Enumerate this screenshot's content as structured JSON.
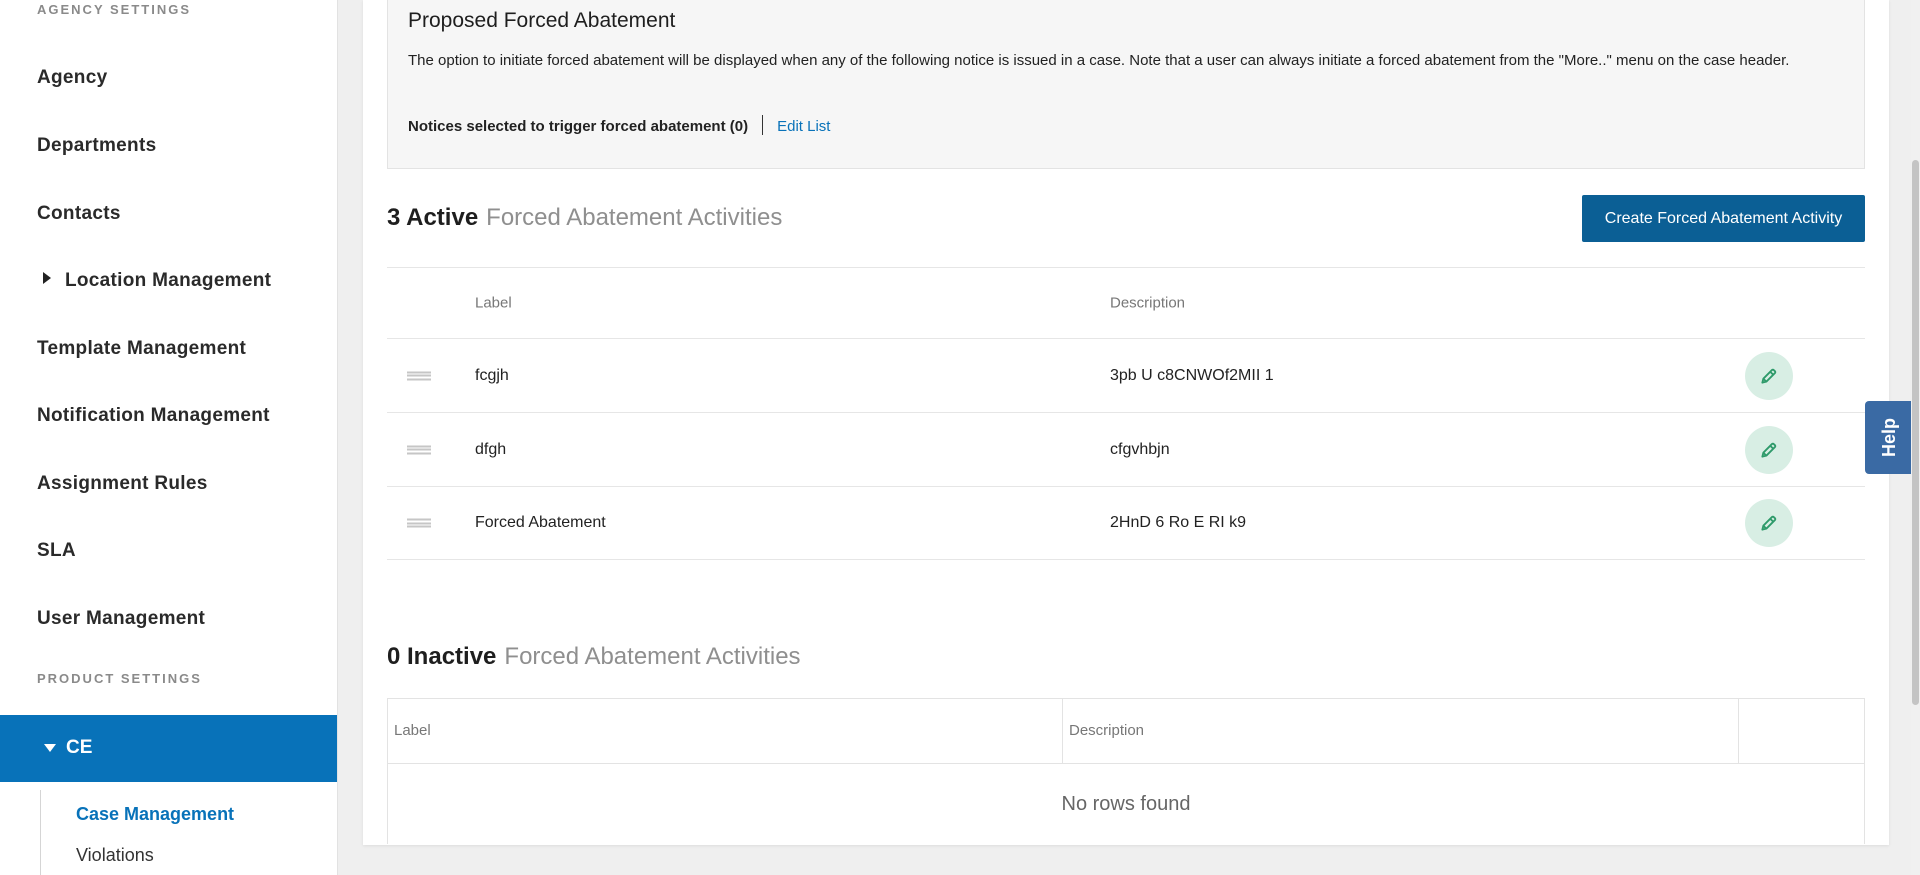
{
  "sidebar": {
    "agency_settings_label": "AGENCY SETTINGS",
    "items": [
      {
        "label": "Agency"
      },
      {
        "label": "Departments"
      },
      {
        "label": "Contacts"
      },
      {
        "label": "Location Management",
        "expandable": true
      },
      {
        "label": "Template Management"
      },
      {
        "label": "Notification Management"
      },
      {
        "label": "Assignment Rules"
      },
      {
        "label": "SLA"
      },
      {
        "label": "User Management"
      }
    ],
    "product_settings_label": "PRODUCT SETTINGS",
    "active_item": {
      "label": "CE",
      "expanded": true
    },
    "sub_items": [
      {
        "label": "Case Management",
        "current": true
      },
      {
        "label": "Violations"
      }
    ]
  },
  "proposed": {
    "title": "Proposed Forced Abatement",
    "description": "The option to initiate forced abatement will be displayed when any of the following notice is issued in a case. Note that a user can always initiate a forced abatement from the \"More..\" menu on the case header.",
    "notices_label": "Notices selected to trigger forced abatement (0)",
    "edit_link": "Edit List"
  },
  "active": {
    "count_label": "3 Active",
    "section_label": "Forced Abatement Activities",
    "create_button": "Create Forced Abatement Activity",
    "columns": {
      "label": "Label",
      "description": "Description"
    },
    "rows": [
      {
        "label": "fcgjh",
        "description": "3pb U c8CNWOf2MII 1"
      },
      {
        "label": "dfgh",
        "description": "cfgvhbjn"
      },
      {
        "label": "Forced Abatement",
        "description": "2HnD 6 Ro E RI k9"
      }
    ]
  },
  "inactive": {
    "count_label": "0 Inactive",
    "section_label": "Forced Abatement Activities",
    "columns": {
      "label": "Label",
      "description": "Description"
    },
    "empty_text": "No rows found"
  },
  "help": {
    "label": "Help"
  },
  "colors": {
    "primary": "#0872b9",
    "button": "#0b5f95",
    "edit_icon": "#2e9a6a",
    "edit_bg": "#d8eee4",
    "help_tab": "#3a6aa4"
  },
  "icons": {
    "drag": "drag-handle-icon",
    "edit": "pencil-icon",
    "expand": "caret-right-icon",
    "collapse": "caret-down-icon"
  }
}
